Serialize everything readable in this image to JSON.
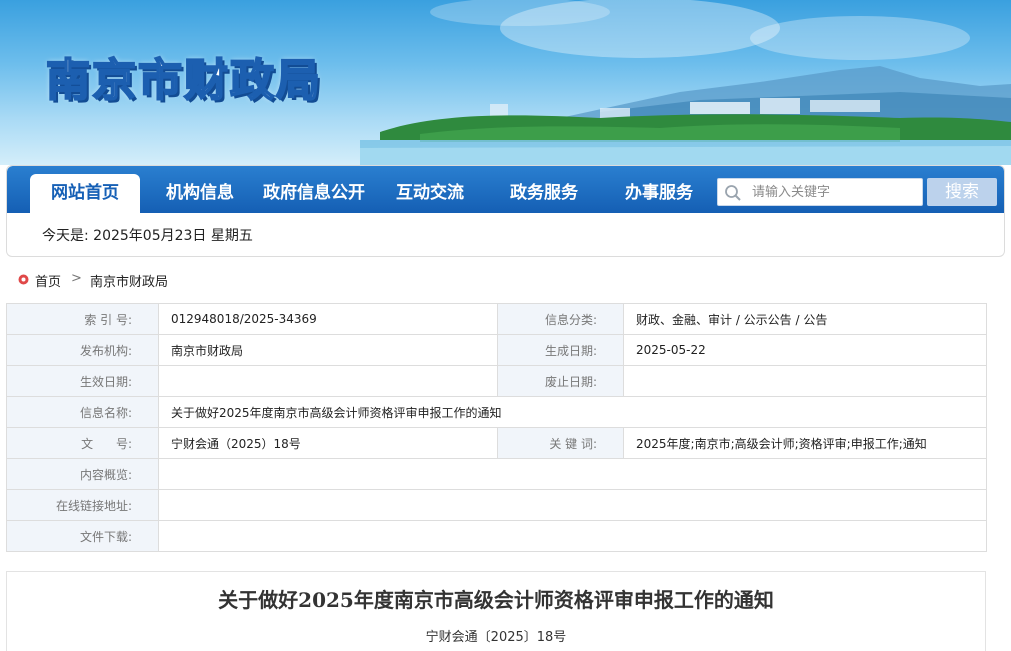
{
  "header": {
    "site_title": "南京市财政局"
  },
  "nav": {
    "items": [
      {
        "label": "网站首页",
        "active": true
      },
      {
        "label": "机构信息",
        "active": false
      },
      {
        "label": "政府信息公开",
        "active": false
      },
      {
        "label": "互动交流",
        "active": false
      },
      {
        "label": "政务服务",
        "active": false
      },
      {
        "label": "办事服务",
        "active": false
      }
    ],
    "search_placeholder": "请输入关键字",
    "search_button": "搜索",
    "date_text": "今天是: 2025年05月23日 星期五"
  },
  "breadcrumb": {
    "home": "首页",
    "separator": ">",
    "current": "南京市财政局"
  },
  "info": {
    "index_label": "索 引 号:",
    "index_value": "012948018/2025-34369",
    "category_label": "信息分类:",
    "category_value": "财政、金融、审计 / 公示公告 / 公告",
    "publisher_label": "发布机构:",
    "publisher_value": "南京市财政局",
    "created_label": "生成日期:",
    "created_value": "2025-05-22",
    "effective_label": "生效日期:",
    "effective_value": "",
    "abolish_label": "废止日期:",
    "abolish_value": "",
    "name_label": "信息名称:",
    "name_value": "关于做好2025年度南京市高级会计师资格评审申报工作的通知",
    "docno_label": "文      号:",
    "docno_value": "宁财会通（2025）18号",
    "keywords_label": "关 键 词:",
    "keywords_value": "2025年度;南京市;高级会计师;资格评审;申报工作;通知",
    "overview_label": "内容概览:",
    "overview_value": "",
    "link_label": "在线链接地址:",
    "link_value": "",
    "download_label": "文件下载:",
    "download_value": ""
  },
  "article": {
    "title": "关于做好2025年度南京市高级会计师资格评审申报工作的通知",
    "doc_number": "宁财会通〔2025〕18号"
  },
  "colors": {
    "nav_blue": "#1660b6",
    "label_bg": "#f1f5fa",
    "search_button_bg": "#bcd2ec"
  }
}
